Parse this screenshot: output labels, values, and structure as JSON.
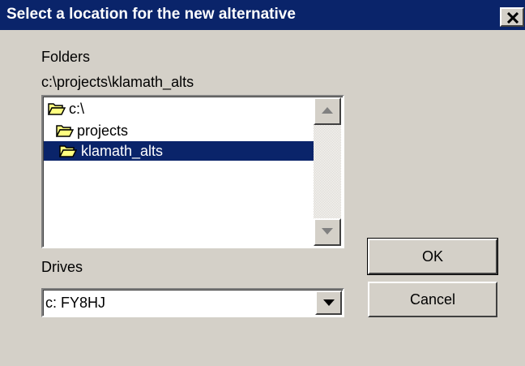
{
  "window": {
    "title": "Select a location for the new alternative",
    "close_icon": "close-icon"
  },
  "folders": {
    "label": "Folders",
    "current_path": "c:\\projects\\klamath_alts",
    "items": [
      {
        "label": "c:\\",
        "icon": "folder-open-icon",
        "selected": false
      },
      {
        "label": "projects",
        "icon": "folder-open-icon",
        "selected": false
      },
      {
        "label": "klamath_alts",
        "icon": "folder-open-icon",
        "selected": true
      }
    ]
  },
  "drives": {
    "label": "Drives",
    "selected": "c: FY8HJ"
  },
  "buttons": {
    "ok_label": "OK",
    "cancel_label": "Cancel"
  },
  "colors": {
    "title_bar": "#0a246a",
    "selection": "#0a246a",
    "face": "#d4d0c8",
    "folder_icon": "#ffff80"
  }
}
